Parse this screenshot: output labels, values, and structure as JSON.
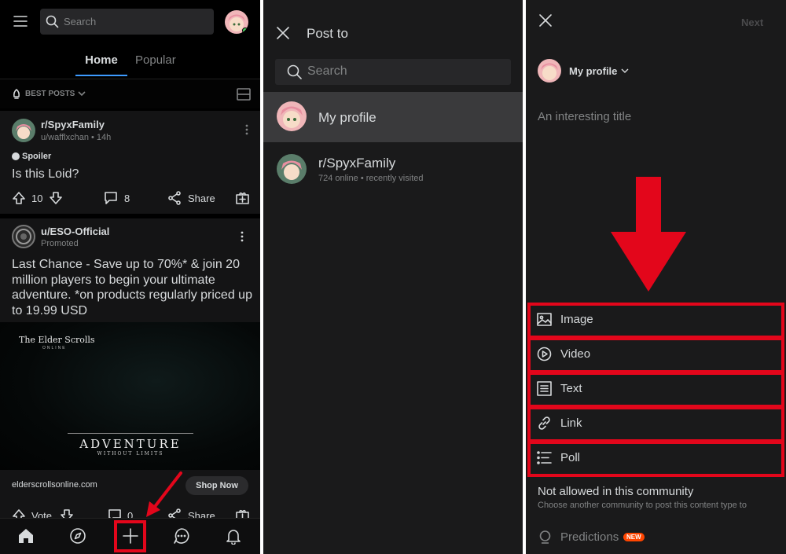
{
  "panel_home": {
    "search_placeholder": "Search",
    "tabs": {
      "home": "Home",
      "popular": "Popular"
    },
    "sort_label": "BEST POSTS",
    "post1": {
      "community": "r/SpyxFamily",
      "meta": "u/wafflxchan • 14h",
      "flair": "Spoiler",
      "title": "Is this Loid?",
      "votes": "10",
      "comments": "8",
      "share": "Share"
    },
    "ad": {
      "author": "u/ESO-Official",
      "promoted": "Promoted",
      "title": "Last Chance - Save up to 70%* & join 20 million players to begin your ultimate adventure. *on products regularly priced up to 19.99 USD",
      "brand": "The Elder Scrolls",
      "brand_sub": "ONLINE",
      "banner": "ADVENTURE",
      "banner_sub": "WITHOUT LIMITS",
      "domain": "elderscrollsonline.com",
      "cta": "Shop Now",
      "vote_label": "Vote",
      "comments": "0",
      "share": "Share"
    }
  },
  "panel_postto": {
    "title": "Post to",
    "search_placeholder": "Search",
    "items": [
      {
        "name": "My profile",
        "sub": ""
      },
      {
        "name": "r/SpyxFamily",
        "sub": "724 online • recently visited"
      }
    ]
  },
  "panel_create": {
    "next_label": "Next",
    "profile_label": "My profile",
    "title_placeholder": "An interesting title",
    "options": [
      "Image",
      "Video",
      "Text",
      "Link",
      "Poll"
    ],
    "not_allowed_title": "Not allowed in this community",
    "not_allowed_sub": "Choose another community to post this content type to",
    "predictions_label": "Predictions",
    "new_badge": "NEW"
  },
  "colors": {
    "highlight": "#e3061b",
    "accent": "#3d9bff",
    "badge": "#ff4500"
  },
  "icons": [
    "menu-icon",
    "search-icon",
    "close-icon",
    "upvote-icon",
    "downvote-icon",
    "comment-icon",
    "share-icon",
    "award-icon",
    "home-icon",
    "explore-icon",
    "plus-icon",
    "chat-icon",
    "bell-icon",
    "image-icon",
    "video-icon",
    "text-icon",
    "link-icon",
    "poll-icon",
    "predictions-icon",
    "chevron-down-icon",
    "arrow-icon"
  ]
}
